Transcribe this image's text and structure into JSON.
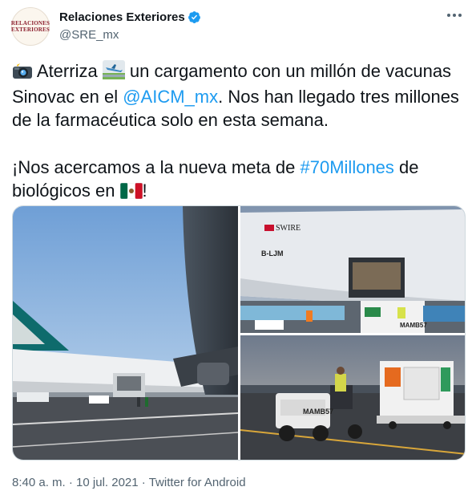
{
  "author": {
    "display_name": "Relaciones Exteriores",
    "handle": "@SRE_mx",
    "avatar_text_line1": "RELACIONES",
    "avatar_text_line2": "EXTERIORES",
    "verified_icon": "verified-badge-icon"
  },
  "more_icon": "more-dots-icon",
  "tweet": {
    "p1_part1": " Aterriza ",
    "p1_part2": " un cargamento con un millón de vacunas Sinovac en el ",
    "mention": "@AICM_mx",
    "p1_part3": ". Nos han llegado tres millones de la farmacéutica solo en esta semana.",
    "p2_part1": "¡Nos acercamos a la nueva meta de ",
    "hashtag": "#70Millones",
    "p2_part2": " de biológicos en ",
    "p2_part3": "!",
    "emojis": [
      "camera-flash-emoji",
      "airplane-arriving-emoji",
      "mexico-flag-emoji"
    ]
  },
  "media": {
    "photo2_airline_label": "SWIRE",
    "photo2_registration": "B-LJM",
    "photo2_container_code": "MAMB57",
    "photo3_container_code": "MAMB57"
  },
  "meta": {
    "time": "8:40 a. m.",
    "date": "10 jul. 2021",
    "source": "Twitter for Android",
    "separator": " · "
  },
  "colors": {
    "link": "#1d9bf0",
    "text": "#0f1419",
    "secondary": "#536471"
  }
}
